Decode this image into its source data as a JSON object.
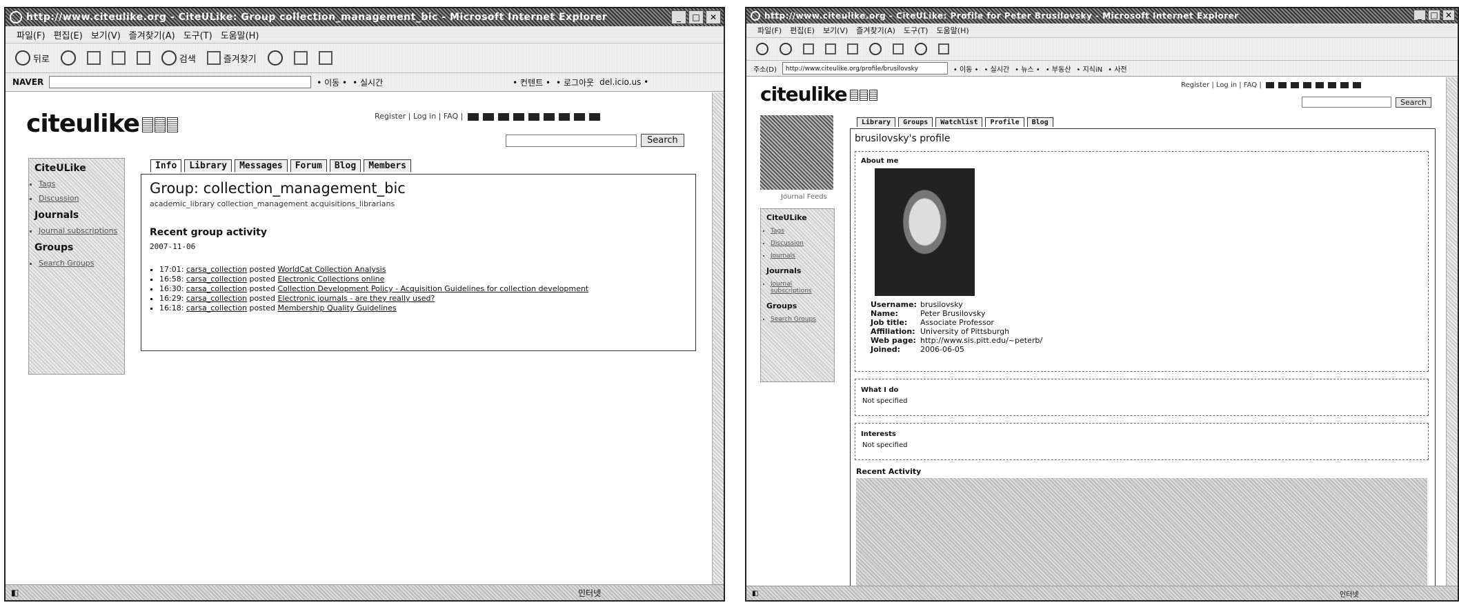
{
  "windowA": {
    "title": "http://www.citeulike.org - CiteULike: Group collection_management_bic - Microsoft Internet Explorer",
    "menu": [
      "파일(F)",
      "편집(E)",
      "보기(V)",
      "즐겨찾기(A)",
      "도구(T)",
      "도움말(H)"
    ],
    "toolbar": {
      "back": "뒤로",
      "search": "검색",
      "favorites": "즐겨찾기"
    },
    "naver_label": "NAVER",
    "naver_links": [
      "• 이동 •",
      "• 실시간",
      "• 컨텐트 •",
      "• 로그아웃",
      "del.icio.us •"
    ],
    "status_zone": "인터넷",
    "site": {
      "logo": "citeulike",
      "top_links": "Register | Log in | FAQ |",
      "search_button": "Search",
      "sidebar": {
        "heading1": "CiteULike",
        "items1": [
          "Tags",
          "Discussion"
        ],
        "heading2": "Journals",
        "items2": [
          "Journal subscriptions"
        ],
        "heading3": "Groups",
        "items3": [
          "Search Groups"
        ]
      },
      "tabs": [
        "Info",
        "Library",
        "Messages",
        "Forum",
        "Blog",
        "Members"
      ],
      "group_title": "Group: collection_management_bic",
      "group_tags": "academic_library collection_management acquisitions_librarians",
      "activity_heading": "Recent group activity",
      "activity_date": "2007-11-06",
      "activity": [
        {
          "time": "17:01:",
          "user": "carsa_collection",
          "verb": "posted",
          "item": "WorldCat Collection Analysis"
        },
        {
          "time": "16:58:",
          "user": "carsa_collection",
          "verb": "posted",
          "item": "Electronic Collections online"
        },
        {
          "time": "16:30:",
          "user": "carsa_collection",
          "verb": "posted",
          "item": "Collection Development Policy - Acquisition Guidelines for collection development"
        },
        {
          "time": "16:29:",
          "user": "carsa_collection",
          "verb": "posted",
          "item": "Electronic journals - are they really used?"
        },
        {
          "time": "16:18:",
          "user": "carsa_collection",
          "verb": "posted",
          "item": "Membership Quality Guidelines"
        }
      ]
    }
  },
  "windowB": {
    "title": "http://www.citeulike.org - CiteULike: Profile for Peter Brusilovsky - Microsoft Internet Explorer",
    "menu": [
      "파일(F)",
      "편집(E)",
      "보기(V)",
      "즐겨찾기(A)",
      "도구(T)",
      "도움말(H)"
    ],
    "address_label": "주소(D)",
    "address": "http://www.citeulike.org/profile/brusilovsky",
    "address_links": [
      "• 이동 •",
      "• 실시간",
      "• 뉴스 •",
      "• 부동산",
      "• 지식iN",
      "• 사전"
    ],
    "status_zone": "인터넷",
    "site": {
      "logo": "citeulike",
      "top_links": "Register | Log in | FAQ |",
      "search_button": "Search",
      "sidebar_caption": "Journal Feeds",
      "sidebar": {
        "heading1": "CiteULike",
        "items1": [
          "Tags",
          "Discussion",
          "Journals"
        ],
        "heading2": "Journals",
        "items2": [
          "Journal subscriptions"
        ],
        "heading3": "Groups",
        "items3": [
          "Search Groups"
        ]
      },
      "tabs": [
        "Library",
        "Groups",
        "Watchlist",
        "Profile",
        "Blog"
      ],
      "profile_title": "brusilovsky's profile",
      "about_heading": "About me",
      "fields": [
        {
          "k": "Username:",
          "v": "brusilovsky"
        },
        {
          "k": "Name:",
          "v": "Peter Brusilovsky"
        },
        {
          "k": "Job title:",
          "v": "Associate Professor"
        },
        {
          "k": "Affiliation:",
          "v": "University of Pittsburgh"
        },
        {
          "k": "Web page:",
          "v": "http://www.sis.pitt.edu/~peterb/"
        },
        {
          "k": "Joined:",
          "v": "2006-06-05"
        }
      ],
      "what_heading": "What I do",
      "what_value": "Not specified",
      "interests_heading": "Interests",
      "interests_value": "Not specified",
      "recent_heading": "Recent Activity"
    }
  }
}
